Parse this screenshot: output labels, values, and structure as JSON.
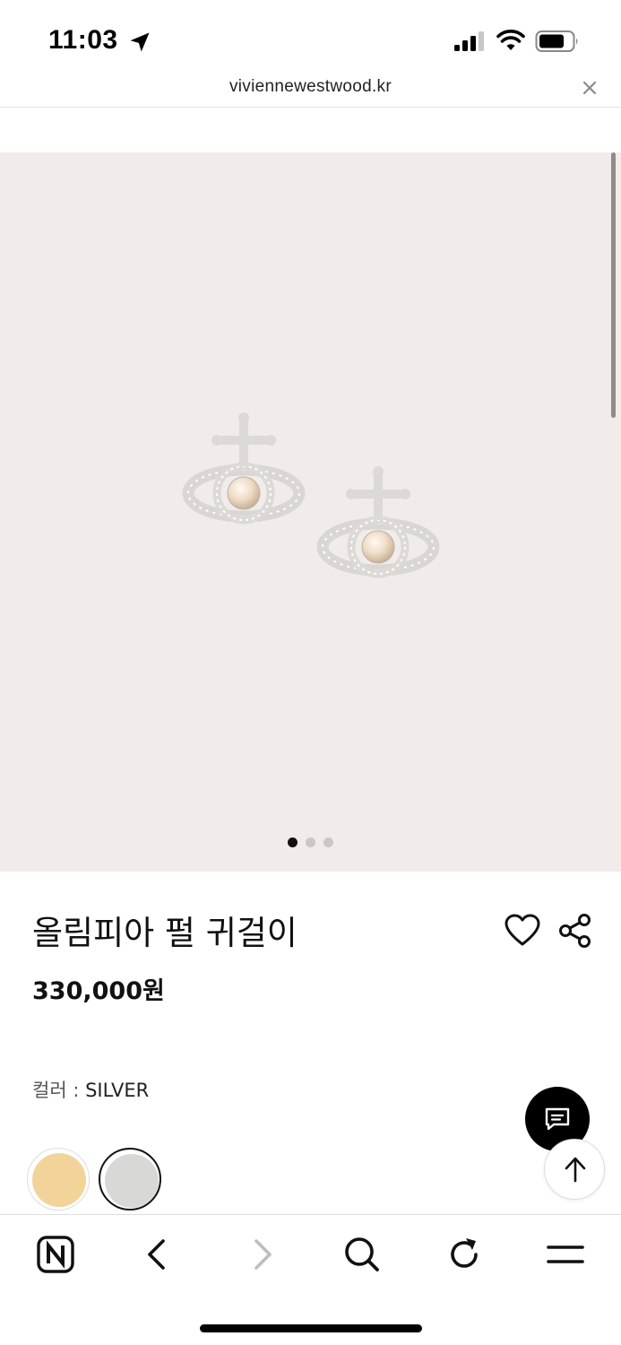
{
  "status_bar": {
    "time": "11:03",
    "icons": [
      "location-arrow-icon",
      "cellular-signal-icon",
      "wifi-icon",
      "battery-icon"
    ]
  },
  "browser": {
    "url": "viviennewestwood.kr",
    "close_icon": "close-icon"
  },
  "hero": {
    "image": "pearl-orb-earrings-image",
    "background_color": "#f1ece9",
    "slide_count": 3,
    "active_slide": 1
  },
  "product": {
    "title": "올림피아 펄 귀걸이",
    "price": "330,000원",
    "color_label": "컬러 :",
    "color_value": "SILVER",
    "swatches": [
      {
        "name": "gold",
        "color": "#f2d49a"
      },
      {
        "name": "silver",
        "color": "#d8d8d6"
      }
    ]
  },
  "actions": {
    "wishlist_icon": "heart-icon",
    "share_icon": "share-icon",
    "chat_icon": "chat-icon",
    "scroll_top_icon": "arrow-up-icon"
  },
  "toolbar": {
    "items": [
      "naver-home-icon",
      "back-arrow-icon",
      "forward-arrow-icon",
      "search-icon",
      "refresh-icon",
      "menu-icon"
    ]
  }
}
